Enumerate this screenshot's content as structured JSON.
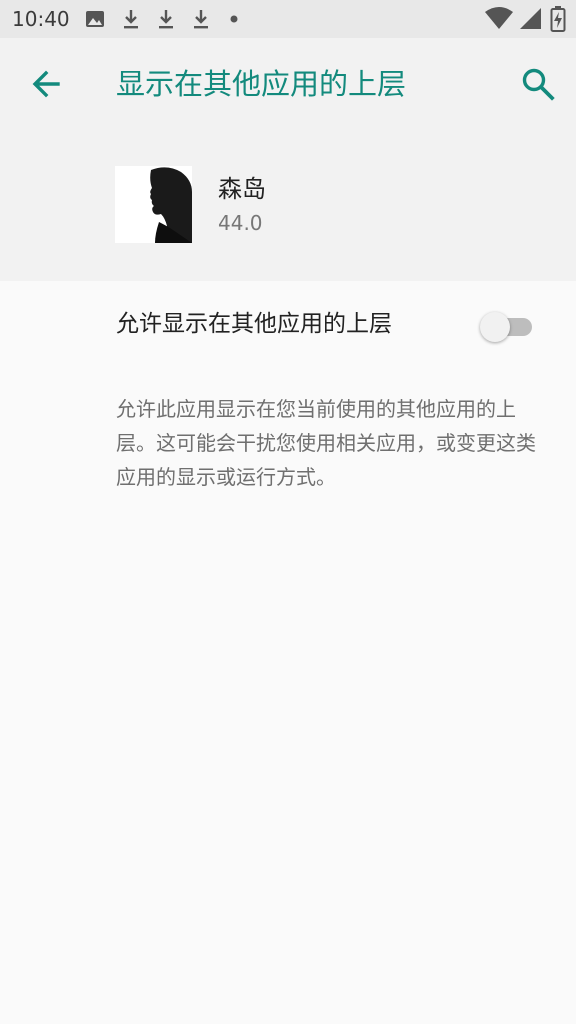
{
  "status_bar": {
    "time": "10:40",
    "left_icons": [
      "image-icon",
      "download-icon",
      "download-icon",
      "download-icon",
      "dot-icon"
    ],
    "right_icons": [
      "wifi-icon",
      "cell-signal-icon",
      "battery-icon"
    ]
  },
  "app_bar": {
    "title": "显示在其他应用的上层",
    "back_icon": "arrow-back-icon",
    "search_icon": "search-icon"
  },
  "app_info": {
    "name": "森岛",
    "version": "44.0"
  },
  "permission": {
    "label": "允许显示在其他应用的上层",
    "enabled": false
  },
  "description": "允许此应用显示在您当前使用的其他应用的上层。这可能会干扰您使用相关应用，或变更这类应用的显示或运行方式。",
  "colors": {
    "accent": "#138a7d",
    "background": "#fafafa",
    "header_background": "#f2f2f2",
    "status_bar": "#e8e8e8"
  }
}
